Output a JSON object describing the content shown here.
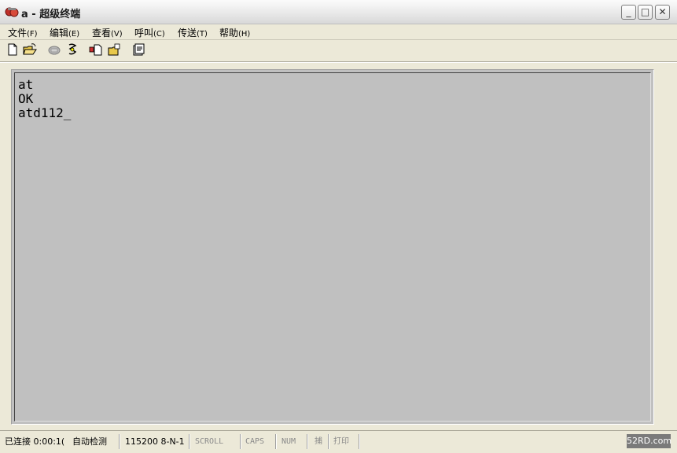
{
  "window": {
    "title": "a - 超级终端",
    "minimize": "_",
    "maximize": "□",
    "close": "✕"
  },
  "menu": [
    {
      "label": "文件",
      "acc": "(F)"
    },
    {
      "label": "编辑",
      "acc": "(E)"
    },
    {
      "label": "查看",
      "acc": "(V)"
    },
    {
      "label": "呼叫",
      "acc": "(C)"
    },
    {
      "label": "传送",
      "acc": "(T)"
    },
    {
      "label": "帮助",
      "acc": "(H)"
    }
  ],
  "toolbar": {
    "icons": [
      "new-icon",
      "open-icon",
      "phone-icon",
      "disconnect-icon",
      "send-icon",
      "receive-icon",
      "properties-icon"
    ]
  },
  "terminal": {
    "lines": [
      "at",
      "OK",
      "atd112_"
    ]
  },
  "status": {
    "connection": "已连接 0:00:1(",
    "detect": "自动检测",
    "settings": "115200 8-N-1",
    "scroll": "SCROLL",
    "caps": "CAPS",
    "num": "NUM",
    "capture": "捕",
    "print": "打印"
  },
  "watermark": "52RD.com",
  "colors": {
    "window_bg": "#ece9d8",
    "terminal_bg": "#c0c0c0"
  }
}
